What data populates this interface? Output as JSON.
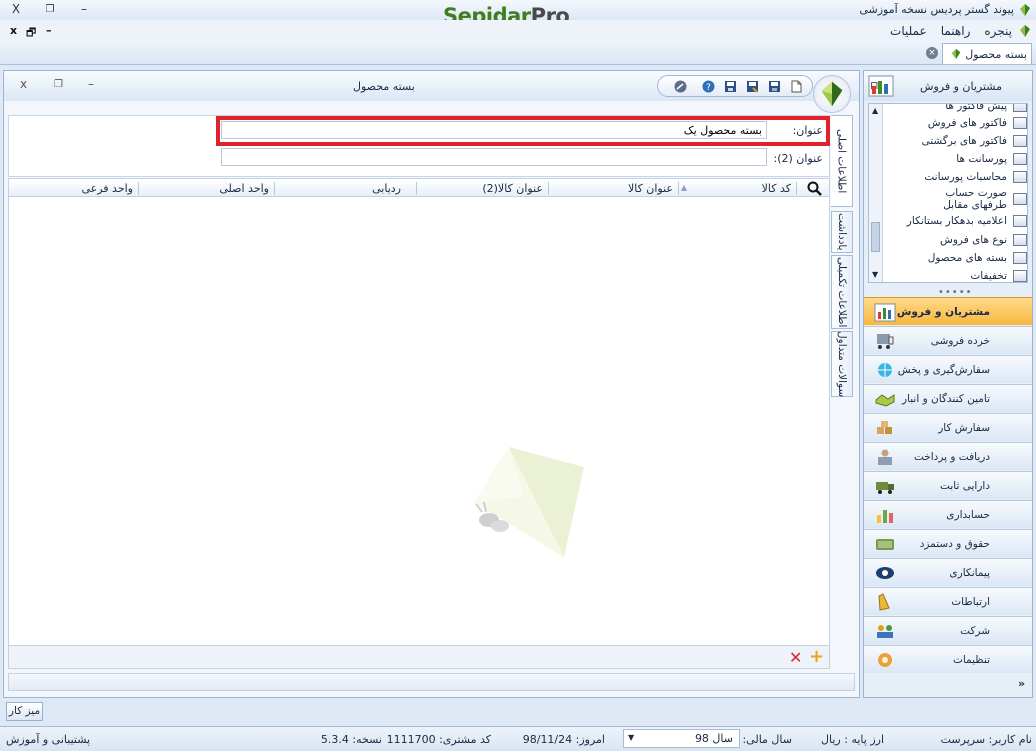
{
  "app": {
    "title": "پیوند گستر پردیس نسخه آموزشی",
    "brand_part1": "Sepidar",
    "brand_part2": "Pro",
    "close_glyph": "X",
    "restore_glyph": "❐",
    "minimize_glyph": "–"
  },
  "menu": {
    "items": [
      "عملیات",
      "راهنما",
      "پنجره"
    ],
    "mdi_close": "x",
    "mdi_restore": "🗗",
    "mdi_minimize": "–"
  },
  "tab": {
    "label": "بسته محصول",
    "close_glyph": "×"
  },
  "window": {
    "title": "بسته محصول",
    "close_glyph": "x",
    "restore_glyph": "❐",
    "minimize_glyph": "–"
  },
  "form": {
    "title_label": "عنوان:",
    "title_value": "بسته محصول یک",
    "title2_label": "عنوان (2):",
    "title2_value": ""
  },
  "grid": {
    "columns": [
      "کد کالا",
      "عنوان کالا",
      "عنوان کالا(2)",
      "ردیابی",
      "واحد اصلی",
      "واحد فرعی"
    ],
    "search_icon": "🔍"
  },
  "vtabs": [
    "اطلاعات اصلی",
    "یادداشت",
    "اطلاعات تکمیلی",
    "سوالات متداول"
  ],
  "nav": {
    "header": "مشتریان و فروش",
    "pin_glyph": "⊓",
    "subitems": [
      "پیش فاکتور ها",
      "فاکتور های فروش",
      "فاکتور های برگشتی",
      "پورسانت ها",
      "محاسبات پورسانت",
      "صورت حساب طرفهای مقابل",
      "اعلامیه بدهکار بستانکار",
      "نوع های فروش",
      "بسته های محصول",
      "تخفیفات"
    ],
    "modules": [
      "مشتریان و فروش",
      "خرده فروشی",
      "سفارش‌گیری و پخش",
      "تامین کنندگان و انبار",
      "سفارش کار",
      "دریافت و پرداخت",
      "دارایی ثابت",
      "حسابداری",
      "حقوق و دستمزد",
      "پیمانکاری",
      "ارتباطات",
      "شرکت",
      "تنظیمات"
    ],
    "splitter_glyph": "•••••",
    "more_glyph": "»"
  },
  "bottom": {
    "desk_button": "میز کار"
  },
  "status": {
    "username": "نام کاربر: سرپرست",
    "base_currency": "ارز پایه : ریال",
    "fiscal_year_label": "سال مالی:",
    "fiscal_year_value": "سال 98",
    "today": "امروز:  98/11/24",
    "customer_code": "کد مشتری:  1111700",
    "version": "نسخه:  5.3.4",
    "support": "پشتیبانی و آموزش"
  },
  "colors": {
    "accent_red": "#e0222b",
    "brand_green": "#3f7d1e",
    "active_nav": "#f8b83c"
  }
}
